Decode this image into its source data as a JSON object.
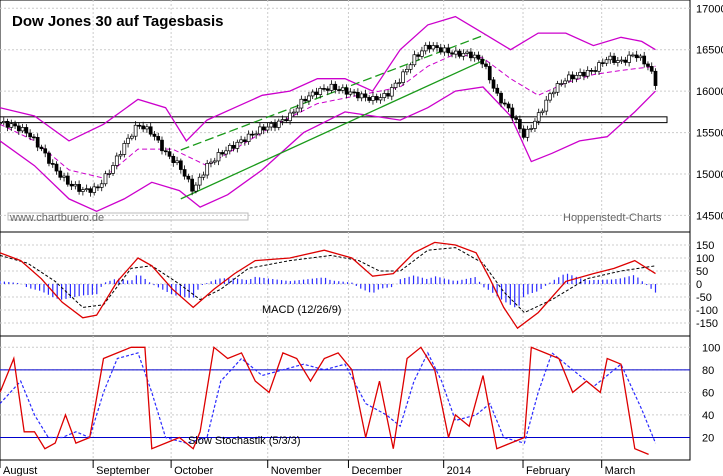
{
  "chart_data": [
    {
      "type": "candlestick",
      "title": "Dow Jones 30 auf Tagesbasis",
      "watermark": "www.chartbuero.de",
      "source": "Hoppenstedt-Charts",
      "ylim": [
        14300,
        17100
      ],
      "yticks": [
        14500,
        15000,
        15500,
        16000,
        16500,
        17000
      ],
      "ytick_labels": [
        "14500",
        "15000",
        "15500",
        "16000",
        "16500",
        "17000"
      ],
      "grid": true,
      "support_zone": [
        15620,
        15690
      ],
      "trend_upper_channel": [
        [
          0.262,
          15290
        ],
        [
          0.703,
          16680
        ]
      ],
      "trend_lower_channel": [
        [
          0.262,
          14700
        ],
        [
          0.703,
          16380
        ]
      ],
      "close_path": [
        [
          0,
          15620
        ],
        [
          0.02,
          15580
        ],
        [
          0.04,
          15500
        ],
        [
          0.06,
          15300
        ],
        [
          0.08,
          15050
        ],
        [
          0.1,
          14880
        ],
        [
          0.12,
          14800
        ],
        [
          0.14,
          14820
        ],
        [
          0.16,
          15050
        ],
        [
          0.18,
          15350
        ],
        [
          0.2,
          15600
        ],
        [
          0.22,
          15500
        ],
        [
          0.24,
          15250
        ],
        [
          0.26,
          15100
        ],
        [
          0.28,
          14800
        ],
        [
          0.3,
          15100
        ],
        [
          0.32,
          15250
        ],
        [
          0.34,
          15350
        ],
        [
          0.36,
          15450
        ],
        [
          0.38,
          15550
        ],
        [
          0.4,
          15600
        ],
        [
          0.42,
          15700
        ],
        [
          0.44,
          15900
        ],
        [
          0.46,
          16000
        ],
        [
          0.48,
          16050
        ],
        [
          0.5,
          16000
        ],
        [
          0.52,
          15950
        ],
        [
          0.54,
          15900
        ],
        [
          0.56,
          15950
        ],
        [
          0.58,
          16150
        ],
        [
          0.6,
          16400
        ],
        [
          0.62,
          16550
        ],
        [
          0.64,
          16500
        ],
        [
          0.66,
          16450
        ],
        [
          0.68,
          16450
        ],
        [
          0.7,
          16350
        ],
        [
          0.72,
          15950
        ],
        [
          0.74,
          15750
        ],
        [
          0.76,
          15450
        ],
        [
          0.78,
          15700
        ],
        [
          0.8,
          16000
        ],
        [
          0.82,
          16150
        ],
        [
          0.84,
          16200
        ],
        [
          0.86,
          16250
        ],
        [
          0.88,
          16400
        ],
        [
          0.9,
          16350
        ],
        [
          0.92,
          16450
        ],
        [
          0.94,
          16300
        ],
        [
          0.95,
          16100
        ]
      ],
      "bollinger_upper": [
        [
          0,
          15800
        ],
        [
          0.05,
          15700
        ],
        [
          0.1,
          15400
        ],
        [
          0.15,
          15600
        ],
        [
          0.2,
          15900
        ],
        [
          0.24,
          15800
        ],
        [
          0.27,
          15400
        ],
        [
          0.3,
          15650
        ],
        [
          0.34,
          15800
        ],
        [
          0.38,
          15950
        ],
        [
          0.42,
          16000
        ],
        [
          0.46,
          16150
        ],
        [
          0.5,
          16150
        ],
        [
          0.54,
          16000
        ],
        [
          0.58,
          16500
        ],
        [
          0.62,
          16800
        ],
        [
          0.66,
          16900
        ],
        [
          0.7,
          16700
        ],
        [
          0.74,
          16500
        ],
        [
          0.78,
          16700
        ],
        [
          0.82,
          16700
        ],
        [
          0.86,
          16550
        ],
        [
          0.9,
          16650
        ],
        [
          0.93,
          16600
        ],
        [
          0.95,
          16500
        ]
      ],
      "bollinger_middle": [
        [
          0,
          15600
        ],
        [
          0.05,
          15400
        ],
        [
          0.1,
          15050
        ],
        [
          0.15,
          14950
        ],
        [
          0.2,
          15300
        ],
        [
          0.25,
          15300
        ],
        [
          0.3,
          15100
        ],
        [
          0.34,
          15300
        ],
        [
          0.4,
          15600
        ],
        [
          0.46,
          15850
        ],
        [
          0.52,
          15950
        ],
        [
          0.58,
          16050
        ],
        [
          0.62,
          16300
        ],
        [
          0.66,
          16450
        ],
        [
          0.7,
          16400
        ],
        [
          0.74,
          16150
        ],
        [
          0.78,
          15950
        ],
        [
          0.82,
          16100
        ],
        [
          0.86,
          16200
        ],
        [
          0.9,
          16250
        ],
        [
          0.95,
          16300
        ]
      ],
      "bollinger_lower": [
        [
          0,
          15400
        ],
        [
          0.05,
          15100
        ],
        [
          0.1,
          14700
        ],
        [
          0.14,
          14550
        ],
        [
          0.18,
          14700
        ],
        [
          0.22,
          14900
        ],
        [
          0.26,
          14800
        ],
        [
          0.29,
          14600
        ],
        [
          0.33,
          14750
        ],
        [
          0.38,
          15050
        ],
        [
          0.44,
          15500
        ],
        [
          0.5,
          15750
        ],
        [
          0.54,
          15700
        ],
        [
          0.58,
          15650
        ],
        [
          0.62,
          15800
        ],
        [
          0.66,
          16000
        ],
        [
          0.7,
          16050
        ],
        [
          0.74,
          15700
        ],
        [
          0.77,
          15150
        ],
        [
          0.8,
          15250
        ],
        [
          0.84,
          15400
        ],
        [
          0.88,
          15450
        ],
        [
          0.92,
          15750
        ],
        [
          0.95,
          16000
        ]
      ]
    },
    {
      "type": "line",
      "indicator": "MACD (12/26/9)",
      "ylim": [
        -200,
        200
      ],
      "yticks": [
        150,
        100,
        50,
        0,
        -50,
        -100,
        -150
      ],
      "ytick_labels": [
        "150",
        "100",
        "50",
        "0",
        "-50",
        "-100",
        "-150"
      ],
      "macd": [
        [
          0,
          120
        ],
        [
          0.03,
          90
        ],
        [
          0.06,
          20
        ],
        [
          0.09,
          -70
        ],
        [
          0.12,
          -130
        ],
        [
          0.14,
          -120
        ],
        [
          0.17,
          10
        ],
        [
          0.2,
          100
        ],
        [
          0.22,
          70
        ],
        [
          0.25,
          -20
        ],
        [
          0.28,
          -90
        ],
        [
          0.31,
          -20
        ],
        [
          0.34,
          40
        ],
        [
          0.37,
          90
        ],
        [
          0.42,
          100
        ],
        [
          0.47,
          130
        ],
        [
          0.51,
          100
        ],
        [
          0.54,
          30
        ],
        [
          0.57,
          40
        ],
        [
          0.6,
          120
        ],
        [
          0.63,
          160
        ],
        [
          0.66,
          150
        ],
        [
          0.69,
          120
        ],
        [
          0.71,
          20
        ],
        [
          0.73,
          -90
        ],
        [
          0.75,
          -170
        ],
        [
          0.78,
          -110
        ],
        [
          0.82,
          10
        ],
        [
          0.86,
          40
        ],
        [
          0.89,
          60
        ],
        [
          0.92,
          90
        ],
        [
          0.95,
          40
        ]
      ],
      "signal": [
        [
          0,
          110
        ],
        [
          0.04,
          80
        ],
        [
          0.08,
          10
        ],
        [
          0.12,
          -90
        ],
        [
          0.15,
          -80
        ],
        [
          0.19,
          60
        ],
        [
          0.22,
          70
        ],
        [
          0.26,
          0
        ],
        [
          0.29,
          -60
        ],
        [
          0.32,
          -20
        ],
        [
          0.36,
          60
        ],
        [
          0.42,
          90
        ],
        [
          0.48,
          110
        ],
        [
          0.52,
          90
        ],
        [
          0.55,
          50
        ],
        [
          0.58,
          50
        ],
        [
          0.62,
          130
        ],
        [
          0.66,
          140
        ],
        [
          0.7,
          80
        ],
        [
          0.73,
          -30
        ],
        [
          0.76,
          -110
        ],
        [
          0.8,
          -60
        ],
        [
          0.85,
          20
        ],
        [
          0.9,
          50
        ],
        [
          0.95,
          70
        ]
      ],
      "histogram_color": "#2a2aff",
      "macd_color": "#dd0000",
      "signal_color": "#000000"
    },
    {
      "type": "line",
      "indicator": "Slow Stochastik (5/3/3)",
      "ylim": [
        0,
        110
      ],
      "yticks": [
        100,
        80,
        60,
        40,
        20
      ],
      "ytick_labels": [
        "100",
        "80",
        "60",
        "40",
        "20"
      ],
      "reference_lines": [
        80,
        20
      ],
      "k": [
        [
          0,
          60
        ],
        [
          0.02,
          90
        ],
        [
          0.035,
          25
        ],
        [
          0.05,
          25
        ],
        [
          0.065,
          10
        ],
        [
          0.08,
          15
        ],
        [
          0.095,
          40
        ],
        [
          0.11,
          15
        ],
        [
          0.13,
          20
        ],
        [
          0.15,
          90
        ],
        [
          0.17,
          95
        ],
        [
          0.19,
          100
        ],
        [
          0.21,
          100
        ],
        [
          0.22,
          10
        ],
        [
          0.24,
          15
        ],
        [
          0.26,
          20
        ],
        [
          0.28,
          10
        ],
        [
          0.29,
          25
        ],
        [
          0.31,
          100
        ],
        [
          0.33,
          90
        ],
        [
          0.35,
          95
        ],
        [
          0.37,
          70
        ],
        [
          0.39,
          60
        ],
        [
          0.41,
          95
        ],
        [
          0.43,
          90
        ],
        [
          0.45,
          70
        ],
        [
          0.47,
          90
        ],
        [
          0.49,
          95
        ],
        [
          0.51,
          80
        ],
        [
          0.53,
          20
        ],
        [
          0.55,
          70
        ],
        [
          0.57,
          10
        ],
        [
          0.59,
          90
        ],
        [
          0.61,
          100
        ],
        [
          0.63,
          80
        ],
        [
          0.65,
          20
        ],
        [
          0.66,
          40
        ],
        [
          0.68,
          30
        ],
        [
          0.7,
          75
        ],
        [
          0.72,
          10
        ],
        [
          0.74,
          15
        ],
        [
          0.76,
          20
        ],
        [
          0.77,
          100
        ],
        [
          0.79,
          95
        ],
        [
          0.81,
          90
        ],
        [
          0.83,
          60
        ],
        [
          0.85,
          70
        ],
        [
          0.87,
          60
        ],
        [
          0.88,
          90
        ],
        [
          0.9,
          85
        ],
        [
          0.92,
          10
        ],
        [
          0.94,
          5
        ]
      ],
      "d": [
        [
          0,
          50
        ],
        [
          0.03,
          70
        ],
        [
          0.05,
          40
        ],
        [
          0.07,
          20
        ],
        [
          0.09,
          20
        ],
        [
          0.11,
          25
        ],
        [
          0.13,
          20
        ],
        [
          0.15,
          60
        ],
        [
          0.17,
          90
        ],
        [
          0.2,
          95
        ],
        [
          0.22,
          60
        ],
        [
          0.24,
          20
        ],
        [
          0.27,
          15
        ],
        [
          0.3,
          20
        ],
        [
          0.32,
          70
        ],
        [
          0.35,
          90
        ],
        [
          0.38,
          75
        ],
        [
          0.41,
          80
        ],
        [
          0.44,
          85
        ],
        [
          0.47,
          80
        ],
        [
          0.5,
          85
        ],
        [
          0.53,
          50
        ],
        [
          0.56,
          40
        ],
        [
          0.58,
          30
        ],
        [
          0.6,
          70
        ],
        [
          0.62,
          95
        ],
        [
          0.64,
          70
        ],
        [
          0.66,
          35
        ],
        [
          0.69,
          40
        ],
        [
          0.71,
          50
        ],
        [
          0.73,
          20
        ],
        [
          0.76,
          15
        ],
        [
          0.78,
          60
        ],
        [
          0.8,
          95
        ],
        [
          0.83,
          80
        ],
        [
          0.86,
          65
        ],
        [
          0.88,
          75
        ],
        [
          0.9,
          85
        ],
        [
          0.93,
          45
        ],
        [
          0.95,
          15
        ]
      ],
      "k_color": "#dd0000",
      "d_color": "#2a2aff",
      "reference_color": "#0000cc"
    }
  ],
  "x_axis": {
    "labels": [
      "August",
      "September",
      "October",
      "November",
      "December",
      "2014",
      "February",
      "March"
    ],
    "positions": [
      0.0,
      0.135,
      0.248,
      0.388,
      0.505,
      0.643,
      0.758,
      0.872
    ]
  }
}
